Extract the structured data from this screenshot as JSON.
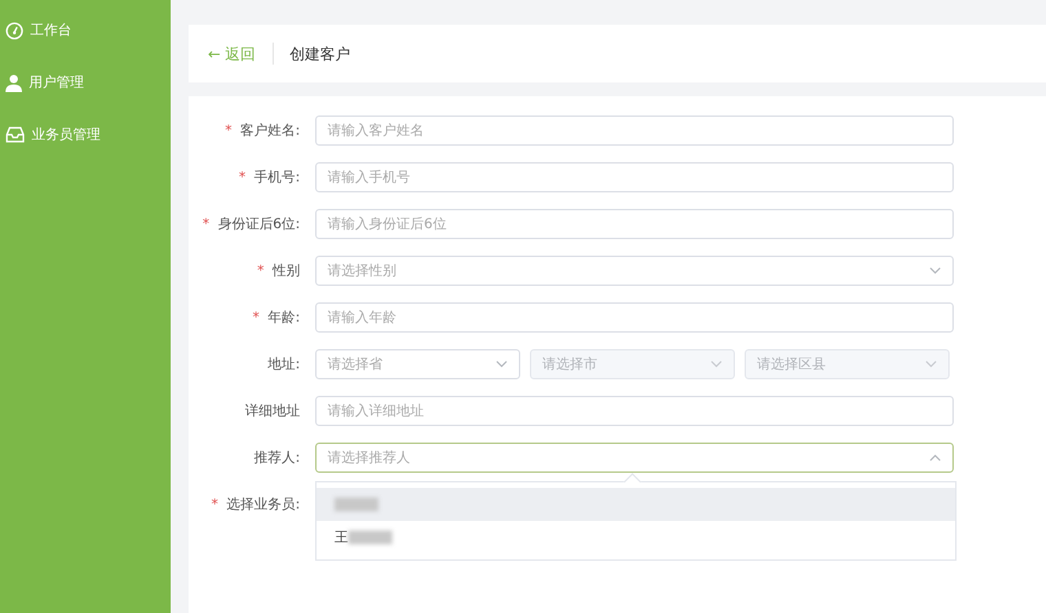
{
  "sidebar": {
    "items": [
      {
        "label": "工作台",
        "selected": false
      },
      {
        "label": "用户管理",
        "selected": false
      },
      {
        "label": "业务员管理",
        "selected": false
      }
    ]
  },
  "header": {
    "back": "← 返回",
    "title": "创建客户"
  },
  "form": {
    "fields": [
      {
        "mark": "*",
        "label": "客户姓名:",
        "kind": "input",
        "placeholder": "请输入客户姓名"
      },
      {
        "mark": "*",
        "label": "手机号:",
        "kind": "input",
        "placeholder": "请输入手机号"
      },
      {
        "mark": "*",
        "label": "身份证后6位:",
        "kind": "input",
        "placeholder": "请输入身份证后6位"
      },
      {
        "mark": "*",
        "label": "性别",
        "kind": "select",
        "placeholder": "请选择性别",
        "open": false
      },
      {
        "mark": "*",
        "label": "年龄:",
        "kind": "input",
        "placeholder": "请输入年龄"
      },
      {
        "label": "地址:",
        "kind": "address",
        "selects": [
          {
            "placeholder": "请选择省",
            "disabled": false
          },
          {
            "placeholder": "请选择市",
            "disabled": true
          },
          {
            "placeholder": "请选择区县",
            "disabled": true
          }
        ]
      },
      {
        "label": "详细地址",
        "kind": "input",
        "placeholder": "请输入详细地址"
      },
      {
        "label": "推荐人:",
        "kind": "select",
        "placeholder": "请选择推荐人",
        "open": true,
        "options": [
          {
            "redacted": true,
            "selected": true
          },
          {
            "text": "王",
            "redacted": true,
            "selected": false
          }
        ]
      },
      {
        "mark": "*",
        "label": "选择业务员:",
        "kind": "covered"
      }
    ]
  }
}
